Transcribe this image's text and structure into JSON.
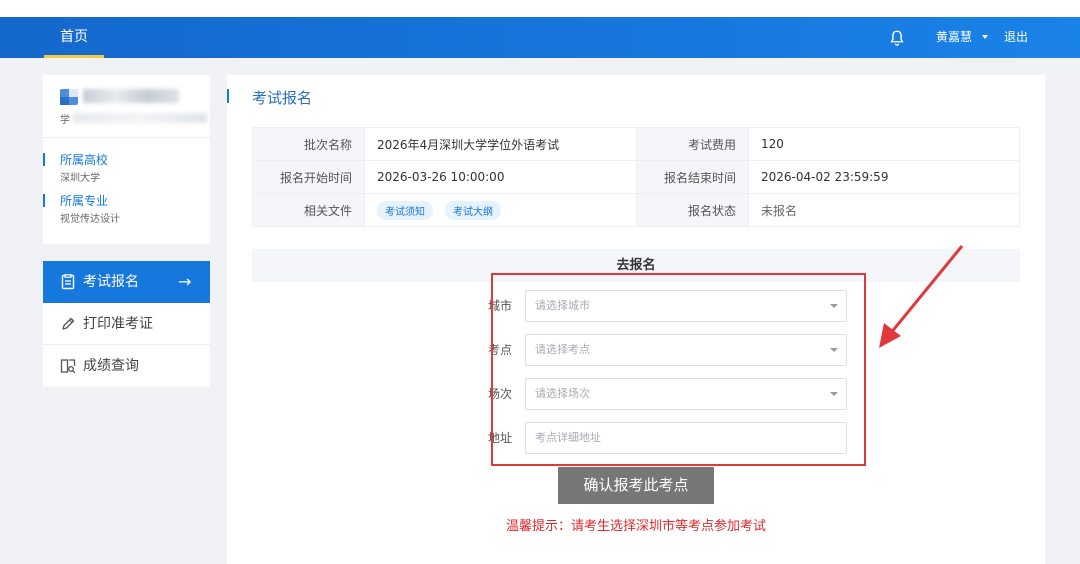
{
  "nav": {
    "home_label": "首页",
    "user_name": "黄嘉慧",
    "logout_label": "退出",
    "brand_color": "#1677dd",
    "icons": [
      "bell-icon",
      "chevron-down-icon"
    ]
  },
  "profile": {
    "student_prefix": "学",
    "school_label": "所属高校",
    "school_value": "深圳大学",
    "major_label": "所属专业",
    "major_value": "视觉传达设计"
  },
  "sidebar": {
    "items": [
      {
        "label": "考试报名",
        "icon": "document-icon",
        "active": true,
        "arrow": "→"
      },
      {
        "label": "打印准考证",
        "icon": "pencil-icon",
        "active": false
      },
      {
        "label": "成绩查询",
        "icon": "search-doc-icon",
        "active": false
      }
    ]
  },
  "main": {
    "title": "考试报名",
    "info": {
      "batch_name_label": "批次名称",
      "batch_name_value": "2026年4月深圳大学学位外语考试",
      "fee_label": "考试费用",
      "fee_value": "120",
      "start_label": "报名开始时间",
      "start_value": "2026-03-26 10:00:00",
      "end_label": "报名结束时间",
      "end_value": "2026-04-02 23:59:59",
      "files_label": "相关文件",
      "file_tags": [
        "考试须知",
        "考试大纲"
      ],
      "status_label": "报名状态",
      "status_value": "未报名"
    },
    "register_header": "去报名",
    "form": {
      "city_label": "城市",
      "city_placeholder": "请选择城市",
      "site_label": "考点",
      "site_placeholder": "请选择考点",
      "session_label": "场次",
      "session_placeholder": "请选择场次",
      "address_label": "地址",
      "address_placeholder": "考点详细地址"
    },
    "confirm_label": "确认报考此考点",
    "tip": "温馨提示：请考生选择深圳市等考点参加考试",
    "annotation_color": "#e0393c"
  }
}
